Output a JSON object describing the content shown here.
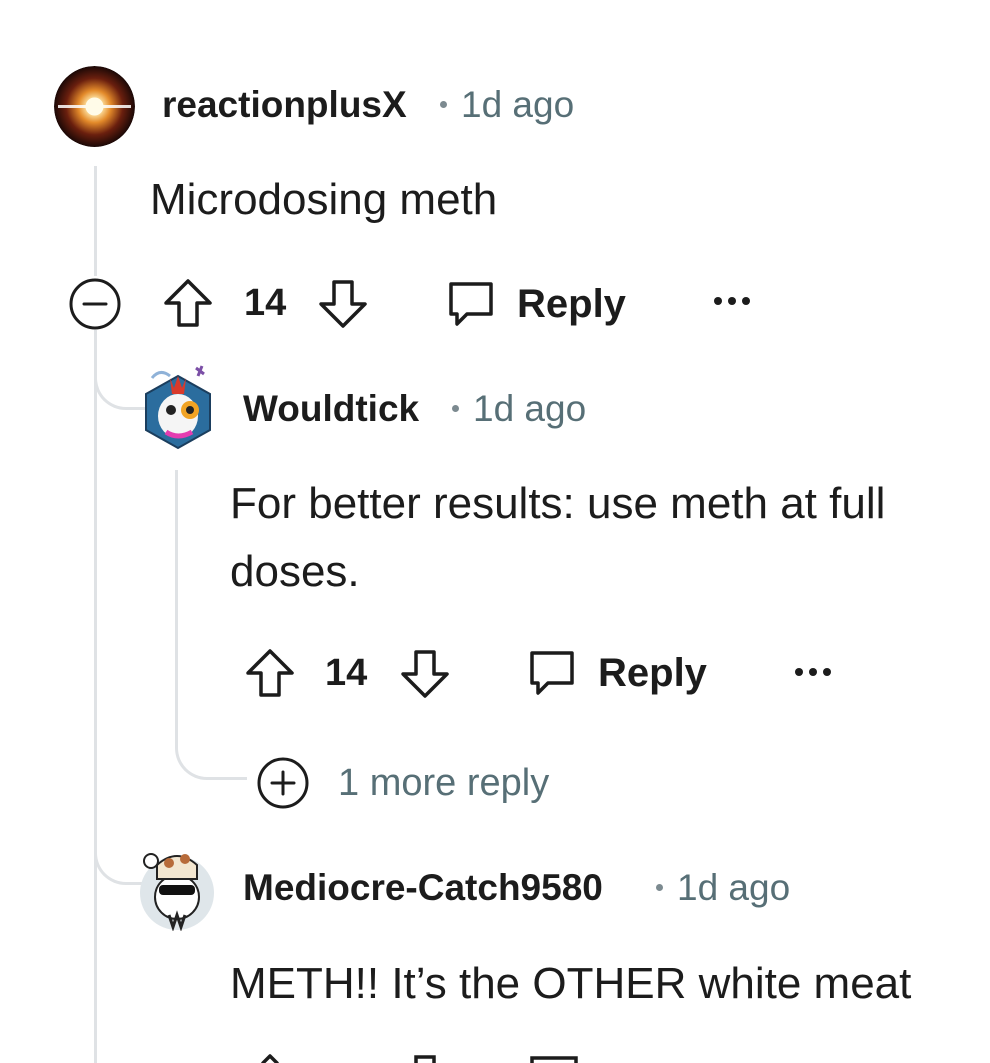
{
  "comments": [
    {
      "username": "reactionplusX",
      "time": "1d ago",
      "body": "Microdosing meth",
      "score": "14",
      "reply_label": "Reply"
    },
    {
      "username": "Wouldtick",
      "time": "1d ago",
      "body": "For better results: use meth at full doses.",
      "score": "14",
      "reply_label": "Reply",
      "more_replies": "1 more reply"
    },
    {
      "username": "Mediocre-Catch9580",
      "time": "1d ago",
      "body": "METH!! It’s the OTHER white meat"
    }
  ],
  "icons": {
    "collapse": "collapse-minus-icon",
    "upvote": "upvote-arrow-icon",
    "downvote": "downvote-arrow-icon",
    "reply": "chat-bubble-icon",
    "overflow": "more-dots-icon",
    "expand": "expand-plus-icon"
  },
  "colors": {
    "text": "#1c1c1c",
    "meta": "#576f76",
    "thread_line": "#dfe2e5"
  }
}
